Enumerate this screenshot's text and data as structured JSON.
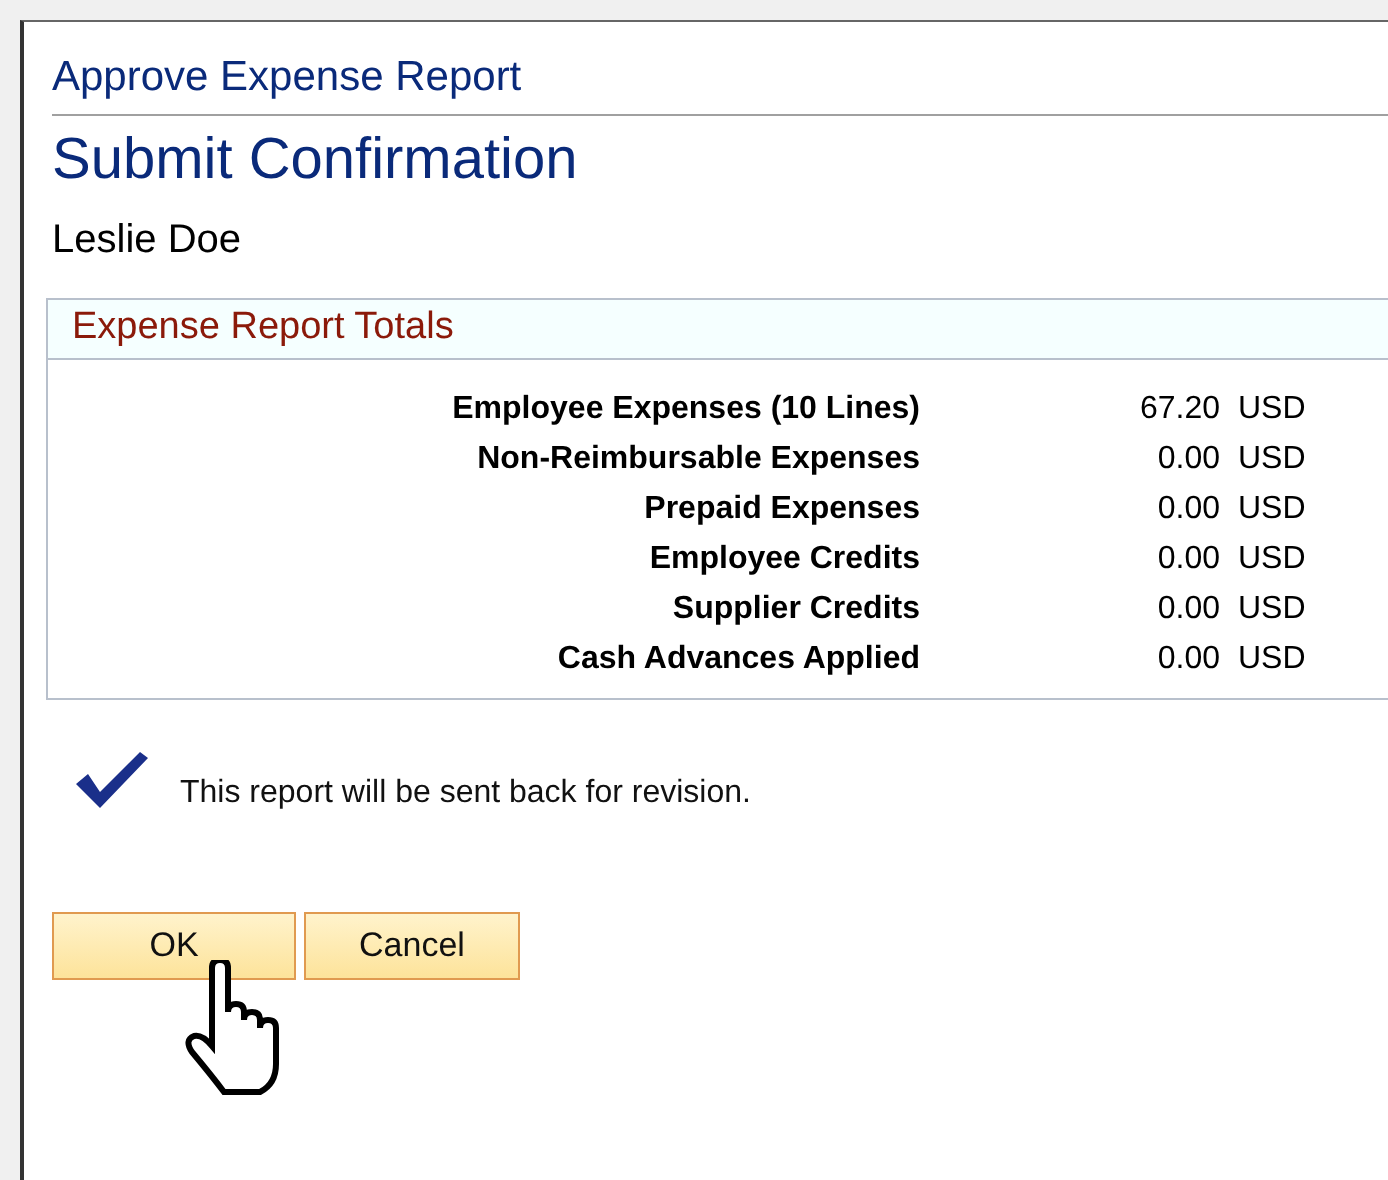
{
  "page_title": "Approve Expense Report",
  "heading": "Submit Confirmation",
  "employee": "Leslie Doe",
  "totals": {
    "title": "Expense Report Totals",
    "rows": [
      {
        "label": "Employee Expenses (10 Lines)",
        "amount": "67.20",
        "currency": "USD"
      },
      {
        "label": "Non-Reimbursable Expenses",
        "amount": "0.00",
        "currency": "USD"
      },
      {
        "label": "Prepaid Expenses",
        "amount": "0.00",
        "currency": "USD"
      },
      {
        "label": "Employee Credits",
        "amount": "0.00",
        "currency": "USD"
      },
      {
        "label": "Supplier Credits",
        "amount": "0.00",
        "currency": "USD"
      },
      {
        "label": "Cash Advances Applied",
        "amount": "0.00",
        "currency": "USD"
      }
    ]
  },
  "message": "This report will be sent back for revision.",
  "buttons": [
    "OK",
    "Cancel"
  ]
}
